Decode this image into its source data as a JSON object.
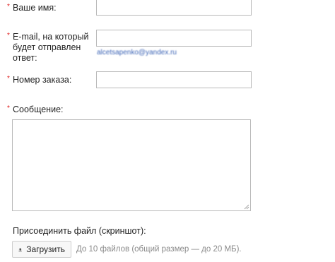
{
  "form": {
    "required_mark": "*",
    "name_label": "Ваше имя:",
    "email_label_line1": "E-mail, на который",
    "email_label_line2": "будет отправлен",
    "email_label_line3": "ответ:",
    "email_hint": "alcetsapenko@yandex.ru",
    "order_label": "Номер заказа:",
    "message_label": "Сообщение:",
    "attach_label": "Присоединить файл (скриншот):",
    "upload_button": "Загрузить",
    "upload_note": "До 10 файлов (общий размер — до 20 МБ).",
    "upload_icon": "upload-icon"
  }
}
